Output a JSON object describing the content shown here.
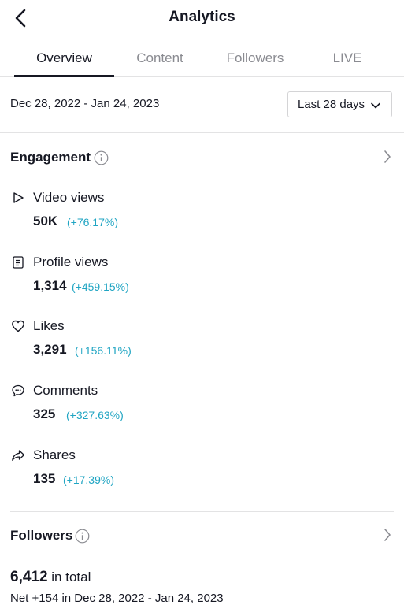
{
  "header": {
    "title": "Analytics",
    "back_icon": "chevron-left-icon"
  },
  "tabs": [
    {
      "label": "Overview",
      "active": true
    },
    {
      "label": "Content",
      "active": false
    },
    {
      "label": "Followers",
      "active": false
    },
    {
      "label": "LIVE",
      "active": false
    }
  ],
  "date_range": {
    "text": "Dec 28, 2022 - Jan 24, 2023",
    "period_label": "Last 28 days"
  },
  "engagement": {
    "title": "Engagement",
    "metrics": [
      {
        "icon": "play-icon",
        "label": "Video views",
        "value": "50K",
        "change": "(+76.17%)"
      },
      {
        "icon": "profile-card-icon",
        "label": "Profile views",
        "value": "1,314",
        "change": "(+459.15%)"
      },
      {
        "icon": "heart-icon",
        "label": "Likes",
        "value": "3,291",
        "change": "(+156.11%)"
      },
      {
        "icon": "comment-icon",
        "label": "Comments",
        "value": "325",
        "change": "(+327.63%)"
      },
      {
        "icon": "share-icon",
        "label": "Shares",
        "value": "135",
        "change": "(+17.39%)"
      }
    ]
  },
  "followers": {
    "title": "Followers",
    "total_value": "6,412",
    "total_suffix": "in total",
    "net_text": "Net +154 in Dec 28, 2022 - Jan 24, 2023"
  },
  "colors": {
    "positive_change": "#20a5c3",
    "text": "#161823",
    "muted": "#8a8b91"
  }
}
